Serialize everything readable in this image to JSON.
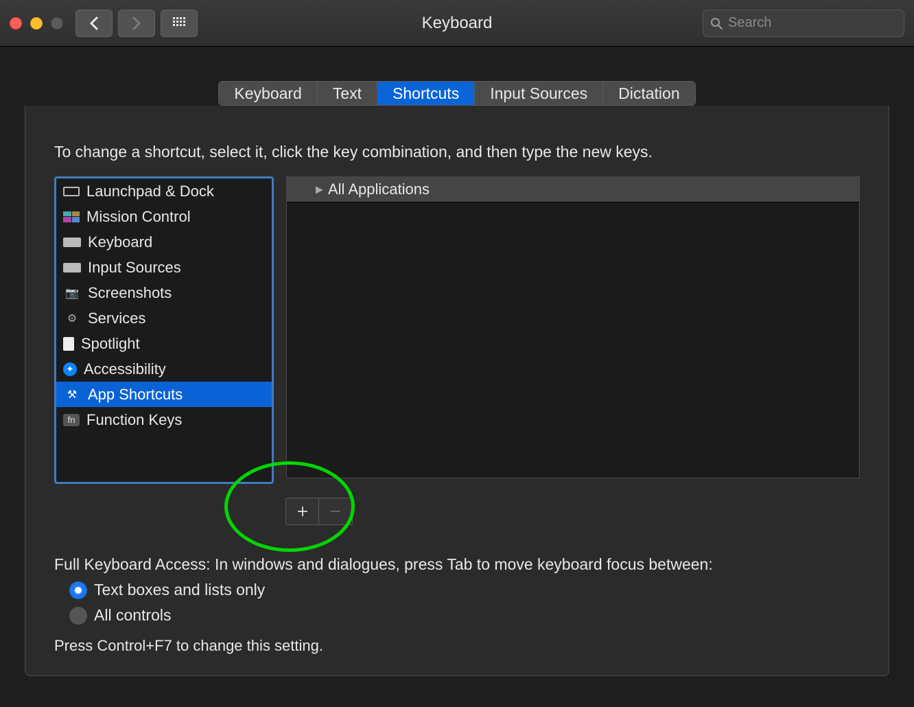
{
  "window": {
    "title": "Keyboard"
  },
  "search": {
    "placeholder": "Search"
  },
  "tabs": [
    {
      "label": "Keyboard",
      "active": false
    },
    {
      "label": "Text",
      "active": false
    },
    {
      "label": "Shortcuts",
      "active": true
    },
    {
      "label": "Input Sources",
      "active": false
    },
    {
      "label": "Dictation",
      "active": false
    }
  ],
  "instruction": "To change a shortcut, select it, click the key combination, and then type the new keys.",
  "categories": [
    {
      "label": "Launchpad & Dock",
      "icon": "launchpad",
      "selected": false
    },
    {
      "label": "Mission Control",
      "icon": "mission-control",
      "selected": false
    },
    {
      "label": "Keyboard",
      "icon": "keyboard",
      "selected": false
    },
    {
      "label": "Input Sources",
      "icon": "keyboard",
      "selected": false
    },
    {
      "label": "Screenshots",
      "icon": "camera",
      "selected": false
    },
    {
      "label": "Services",
      "icon": "gear",
      "selected": false
    },
    {
      "label": "Spotlight",
      "icon": "spotlight",
      "selected": false
    },
    {
      "label": "Accessibility",
      "icon": "accessibility",
      "selected": false
    },
    {
      "label": "App Shortcuts",
      "icon": "app",
      "selected": true
    },
    {
      "label": "Function Keys",
      "icon": "fn",
      "selected": false
    }
  ],
  "shortcut_groups": [
    {
      "label": "All Applications"
    }
  ],
  "buttons": {
    "add": "+",
    "remove": "−"
  },
  "full_keyboard": {
    "heading": "Full Keyboard Access: In windows and dialogues, press Tab to move keyboard focus between:",
    "options": [
      {
        "label": "Text boxes and lists only",
        "selected": true
      },
      {
        "label": "All controls",
        "selected": false
      }
    ],
    "hint": "Press Control+F7 to change this setting."
  },
  "icons": {
    "launchpad": "▭",
    "mission-control": "▦",
    "keyboard": "⌨",
    "camera": "📷",
    "gear": "⚙",
    "spotlight": "📄",
    "accessibility": "♿",
    "app": "🛠",
    "fn": "fn"
  }
}
